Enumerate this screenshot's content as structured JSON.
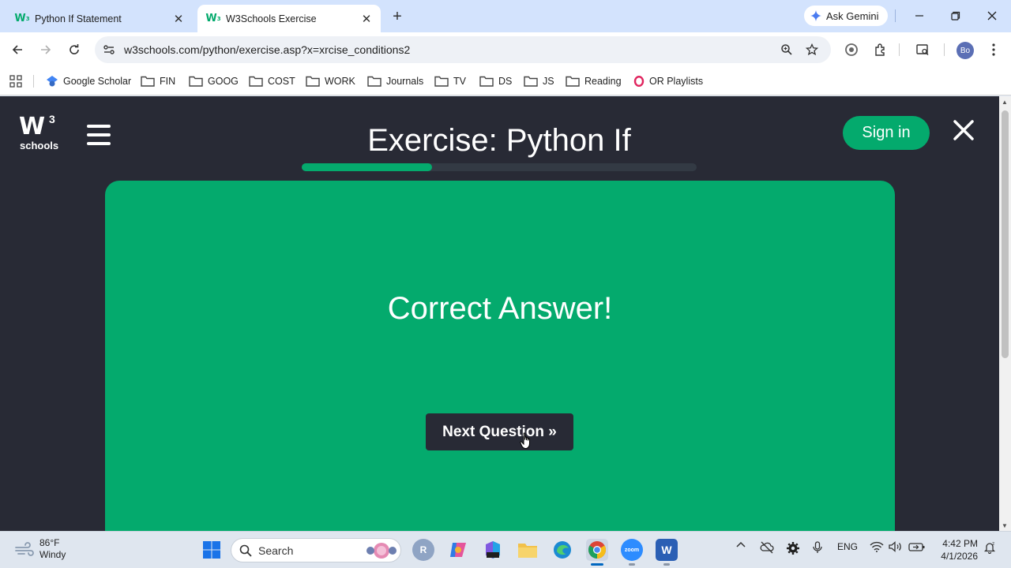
{
  "browser": {
    "tabs": [
      {
        "title": "Python If Statement",
        "active": false
      },
      {
        "title": "W3Schools Exercise",
        "active": true
      }
    ],
    "new_tab_symbol": "+",
    "ask_gemini_label": "Ask Gemini",
    "url": "w3schools.com/python/exercise.asp?x=xrcise_conditions2",
    "profile_initials": "Bo"
  },
  "bookmarks": [
    {
      "label": "Google Scholar",
      "icon": "google-scholar-icon"
    },
    {
      "label": "FIN",
      "icon": "folder-icon"
    },
    {
      "label": "GOOG",
      "icon": "folder-icon"
    },
    {
      "label": "COST",
      "icon": "folder-icon"
    },
    {
      "label": "WORK",
      "icon": "folder-icon"
    },
    {
      "label": "Journals",
      "icon": "folder-icon"
    },
    {
      "label": "TV",
      "icon": "folder-icon"
    },
    {
      "label": "DS",
      "icon": "folder-icon"
    },
    {
      "label": "JS",
      "icon": "folder-icon"
    },
    {
      "label": "Reading",
      "icon": "folder-icon"
    },
    {
      "label": "OR Playlists",
      "icon": "opera-icon"
    }
  ],
  "page": {
    "logo_mark": "W",
    "logo_superscript": "3",
    "logo_text": "schools",
    "exercise_title": "Exercise: Python If",
    "progress_fraction": 0.33,
    "sign_in_label": "Sign in",
    "result_text": "Correct Answer!",
    "next_button_label": "Next Question »"
  },
  "taskbar": {
    "weather_temp": "86°F",
    "weather_desc": "Windy",
    "search_placeholder": "Search",
    "language": "ENG",
    "time": "4:42 PM",
    "date": "4/1/2026"
  },
  "colors": {
    "w3_green": "#04aa6d",
    "page_dark": "#282a35",
    "tab_strip": "#d3e3fd"
  }
}
